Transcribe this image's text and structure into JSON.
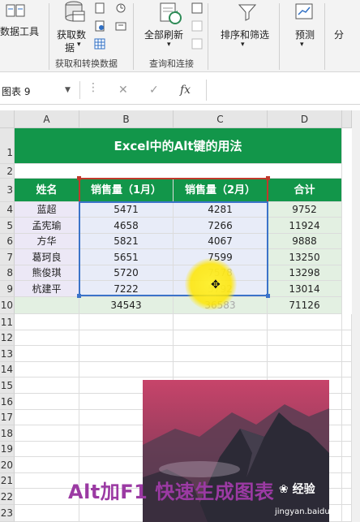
{
  "ribbon": {
    "data_tools_label": "数据工具",
    "get_data_label": "获取数",
    "get_data_label2": "据",
    "refresh_all_label": "全部刷新",
    "sort_filter_label": "排序和筛选",
    "forecast_label": "预测",
    "outline_label": "分",
    "group_get_transform": "获取和转换数据",
    "group_query_connect": "查询和连接"
  },
  "formula_bar": {
    "name_box": "图表 9",
    "cancel_glyph": "✕",
    "enter_glyph": "✓",
    "fx_glyph": "fx"
  },
  "sheet": {
    "columns": [
      "A",
      "B",
      "C",
      "D"
    ],
    "rows": [
      "1",
      "2",
      "3",
      "4",
      "5",
      "6",
      "7",
      "8",
      "9",
      "10",
      "11",
      "12",
      "13",
      "14",
      "15",
      "16",
      "17",
      "18",
      "19",
      "20",
      "21",
      "22",
      "23"
    ],
    "title": "Excel中的Alt键的用法",
    "headers": [
      "姓名",
      "销售量（1月）",
      "销售量（2月）",
      "合计"
    ],
    "records": [
      {
        "name": "蓝超",
        "jan": "5471",
        "feb": "4281",
        "total": "9752"
      },
      {
        "name": "孟宪瑜",
        "jan": "4658",
        "feb": "7266",
        "total": "11924"
      },
      {
        "name": "方华",
        "jan": "5821",
        "feb": "4067",
        "total": "9888"
      },
      {
        "name": "葛珂良",
        "jan": "5651",
        "feb": "7599",
        "total": "13250"
      },
      {
        "name": "熊俊琪",
        "jan": "5720",
        "feb": "7578",
        "total": "13298"
      },
      {
        "name": "杭建平",
        "jan": "7222",
        "feb": "5792",
        "total": "13014"
      }
    ],
    "sums": {
      "jan": "34543",
      "feb": "36583",
      "total": "71126"
    }
  },
  "overlay": {
    "caption": "Alt加F1 快速生成图表",
    "watermark_brand": "经验",
    "watermark_url": "jingyan.baidu.com"
  },
  "colors": {
    "header_green": "#12964a",
    "selection_blue": "#3b73c9",
    "header_selection_red": "#c0392b",
    "caption_purple": "#9b3aa3"
  }
}
